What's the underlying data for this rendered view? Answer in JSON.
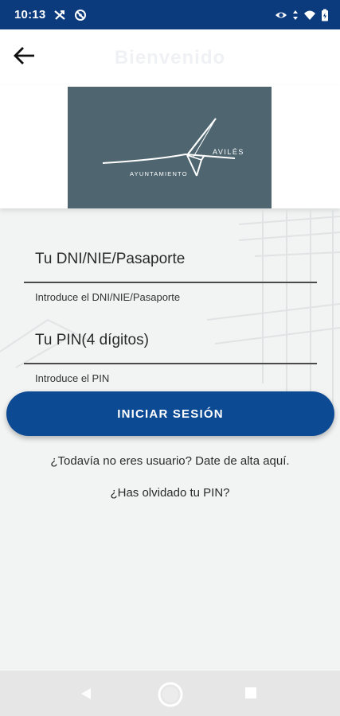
{
  "status_bar": {
    "time": "10:13",
    "icons": [
      "signal-off-icon",
      "blocked-icon",
      "eye-icon",
      "data-arrows-icon",
      "wifi-icon",
      "battery-icon"
    ]
  },
  "app_bar": {
    "back_icon": "arrow-left-icon",
    "title": "Bienvenido"
  },
  "logo": {
    "line1": "AVILÉS",
    "line2": "AYUNTAMIENTO",
    "background": "#4f6671"
  },
  "form": {
    "id_field": {
      "placeholder": "Tu DNI/NIE/Pasaporte",
      "value": "",
      "helper": "Introduce el DNI/NIE/Pasaporte"
    },
    "pin_field": {
      "placeholder": "Tu PIN(4 dígitos)",
      "value": "",
      "helper": "Introduce el PIN"
    },
    "login_button": "INICIAR SESIÓN"
  },
  "links": {
    "register": "¿Todavía no eres usuario? Date de alta aquí.",
    "forgot_pin": "¿Has olvidado tu PIN?"
  },
  "nav_bar": {
    "buttons": [
      "back-triangle-icon",
      "home-circle-icon",
      "recents-square-icon"
    ]
  },
  "colors": {
    "status_bar": "#0b3a7d",
    "primary_button": "#0c4a93",
    "logo_background": "#4f6671"
  }
}
